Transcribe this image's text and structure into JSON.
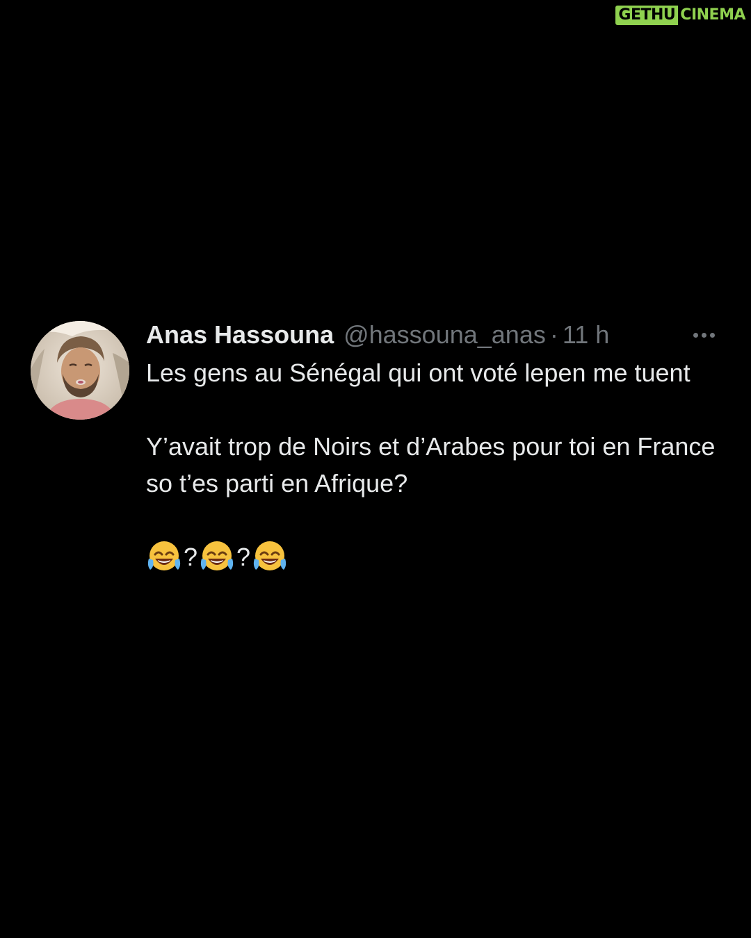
{
  "watermark": {
    "left_text": "GETHU",
    "right_text": "CINEMA",
    "accent_color": "#8fd14f"
  },
  "tweet": {
    "avatar_icon": "profile-photo",
    "display_name": "Anas Hassouna",
    "handle": "@hassouna_anas",
    "separator": "·",
    "timestamp": "11 h",
    "more_icon": "more-horizontal-icon",
    "paragraphs": [
      "Les gens au Sénégal qui ont voté lepen me tuent",
      "Y’avait trop de Noirs et d’Arabes pour toi en France so t’es parti en Afrique?"
    ],
    "emoji_line": {
      "emoji_icon": "face-with-tears-of-joy-icon",
      "separator": "?"
    },
    "colors": {
      "background": "#000000",
      "primary_text": "#e7e9ea",
      "secondary_text": "#71767b"
    }
  }
}
